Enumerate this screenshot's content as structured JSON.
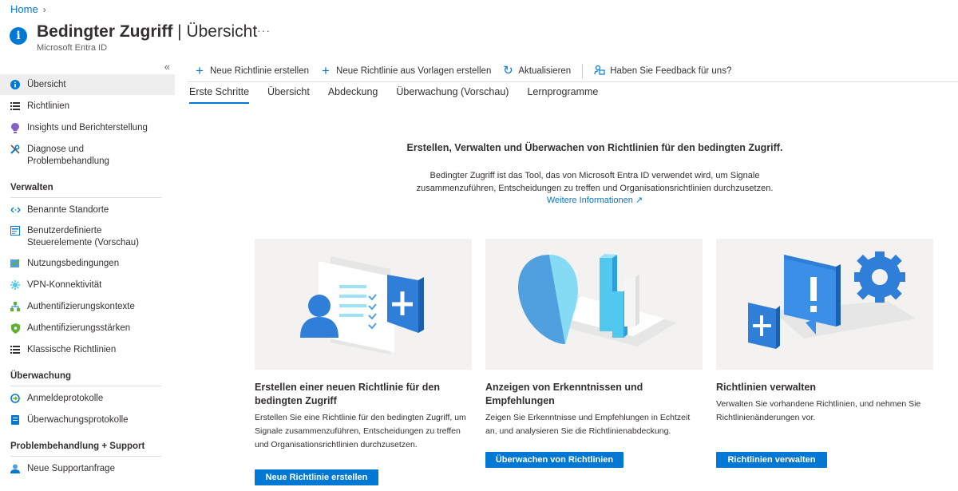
{
  "breadcrumb": {
    "home": "Home"
  },
  "header": {
    "title_bold": "Bedingter Zugriff",
    "title_rest": " | Übersicht",
    "subtitle": "Microsoft Entra ID",
    "more": "···"
  },
  "sidebar": {
    "collapse": "«",
    "items": [
      {
        "label": "Übersicht",
        "icon": "info-icon"
      },
      {
        "label": "Richtlinien",
        "icon": "list-icon"
      },
      {
        "label": "Insights und Berichterstellung",
        "icon": "bulb-icon"
      },
      {
        "label": "Diagnose und Problembehandlung",
        "icon": "wrench-icon"
      }
    ],
    "sections": [
      {
        "title": "Verwalten",
        "items": [
          {
            "label": "Benannte Standorte",
            "icon": "location-icon"
          },
          {
            "label": "Benutzerdefinierte Steuerelemente (Vorschau)",
            "icon": "controls-icon"
          },
          {
            "label": "Nutzungsbedingungen",
            "icon": "terms-icon"
          },
          {
            "label": "VPN-Konnektivität",
            "icon": "vpn-icon"
          },
          {
            "label": "Authentifizierungskontexte",
            "icon": "context-icon"
          },
          {
            "label": "Authentifizierungsstärken",
            "icon": "shield-icon"
          },
          {
            "label": "Klassische Richtlinien",
            "icon": "list-icon"
          }
        ]
      },
      {
        "title": "Überwachung",
        "items": [
          {
            "label": "Anmeldeprotokolle",
            "icon": "signin-log-icon"
          },
          {
            "label": "Überwachungsprotokolle",
            "icon": "audit-log-icon"
          }
        ]
      },
      {
        "title": "Problembehandlung + Support",
        "items": [
          {
            "label": "Neue Supportanfrage",
            "icon": "support-icon"
          }
        ]
      }
    ]
  },
  "toolbar": {
    "new_policy": "Neue Richtlinie erstellen",
    "new_from_template": "Neue Richtlinie aus Vorlagen erstellen",
    "refresh": "Aktualisieren",
    "feedback": "Haben Sie Feedback für uns?"
  },
  "tabs": [
    "Erste Schritte",
    "Übersicht",
    "Abdeckung",
    "Überwachung (Vorschau)",
    "Lernprogramme"
  ],
  "hero": {
    "title": "Erstellen, Verwalten und Überwachen von Richtlinien für den bedingten Zugriff.",
    "desc_line1": "Bedingter Zugriff ist das Tool, das von Microsoft Entra ID verwendet wird, um Signale",
    "desc_line2": "zusammenzuführen, Entscheidungen zu treffen und Organisationsrichtlinien durchzusetzen.",
    "link": "Weitere Informationen"
  },
  "cards": [
    {
      "title": "Erstellen einer neuen Richtlinie für den bedingten Zugriff",
      "desc": "Erstellen Sie eine Richtlinie für den bedingten Zugriff, um Signale zusammenzuführen, Entscheidungen zu treffen und Organisationsrichtlinien durchzusetzen.",
      "button": "Neue Richtlinie erstellen"
    },
    {
      "title": "Anzeigen von Erkenntnissen und Empfehlungen",
      "desc": "Zeigen Sie Erkenntnisse und Empfehlungen in Echtzeit an, und analysieren Sie die Richtlinienabdeckung.",
      "button": "Überwachen von Richtlinien"
    },
    {
      "title": "Richtlinien verwalten",
      "desc": "Verwalten Sie vorhandene Richtlinien, und nehmen Sie Richtlinienänderungen vor.",
      "button": "Richtlinien verwalten"
    }
  ],
  "colors": {
    "accent": "#0078d4",
    "active_bg": "#eeeeee",
    "card_bg": "#f3f2f1"
  }
}
